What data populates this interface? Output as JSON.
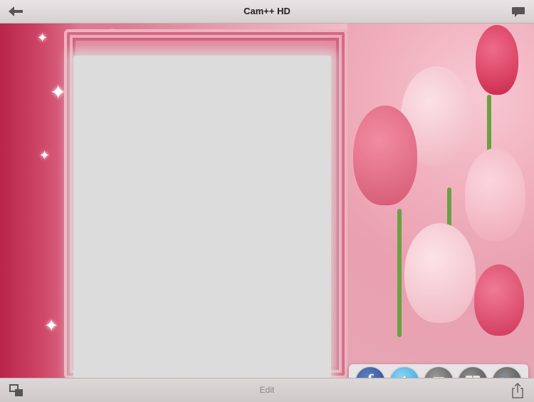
{
  "header": {
    "title": "Cam++ HD",
    "back_icon": "back-arrow-icon",
    "chat_icon": "speech-bubble-icon"
  },
  "footer": {
    "edit_label": "Edit",
    "left_icon": "multi-window-icon",
    "right_icon": "share-export-icon"
  },
  "share_panel": {
    "items": [
      {
        "name": "facebook",
        "glyph": "f"
      },
      {
        "name": "twitter",
        "glyph": "t"
      },
      {
        "name": "mail",
        "glyph": "✉"
      },
      {
        "name": "address-book",
        "glyph": ""
      },
      {
        "name": "folder",
        "glyph": ""
      }
    ]
  },
  "colors": {
    "accent_pink": "#d86c86",
    "frame_bg": "#dddcdc"
  }
}
